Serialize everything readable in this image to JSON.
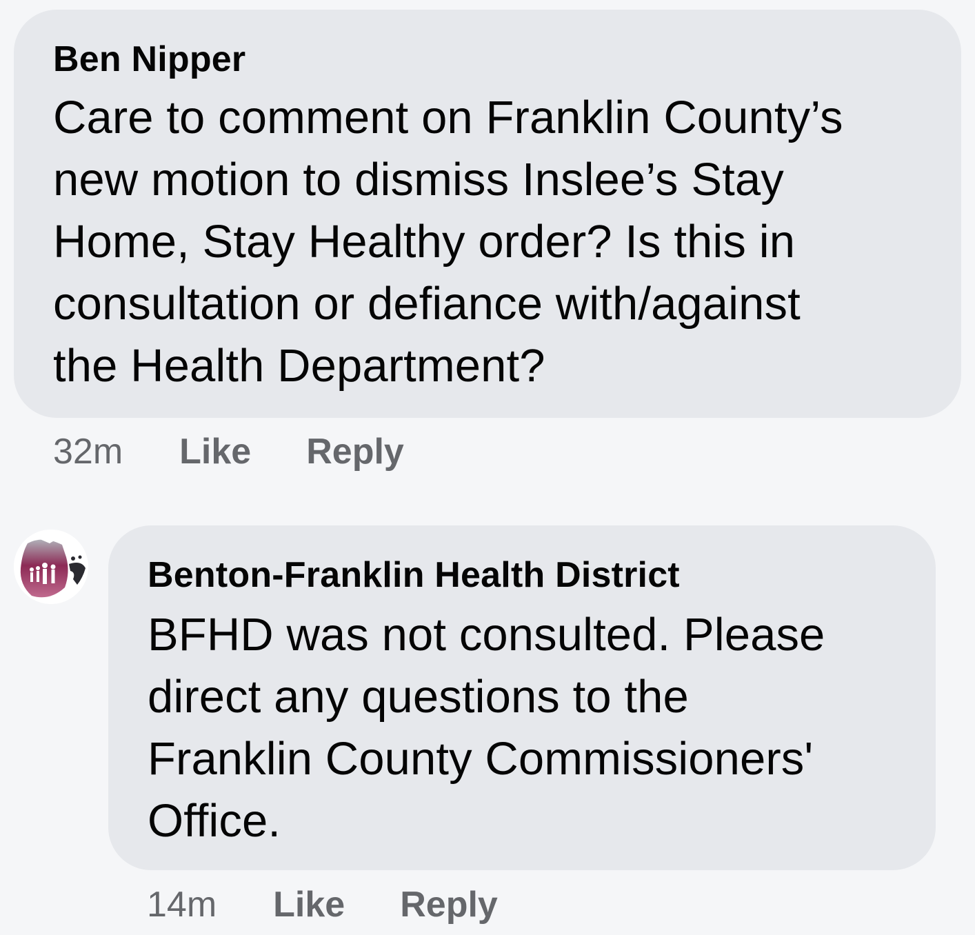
{
  "comments": [
    {
      "author": "Ben Nipper",
      "text_lines": [
        "Care to comment on Franklin County’s",
        "new motion to dismiss Inslee’s Stay",
        "Home, Stay Healthy order? Is this in",
        "consultation or defiance with/against",
        "the Health Department?"
      ],
      "time": "32m",
      "like_label": "Like",
      "reply_label": "Reply"
    },
    {
      "author": "Benton-Franklin Health District",
      "text_lines": [
        "BFHD was not consulted.  Please",
        "direct any questions to the",
        "Franklin County Commissioners'",
        "Office."
      ],
      "time": "14m",
      "like_label": "Like",
      "reply_label": "Reply"
    }
  ],
  "colors": {
    "background": "#f5f6f8",
    "bubble": "#e6e8ec",
    "text": "#050505",
    "secondary_text": "#65676b",
    "avatar_accent": "#8c2a55"
  }
}
